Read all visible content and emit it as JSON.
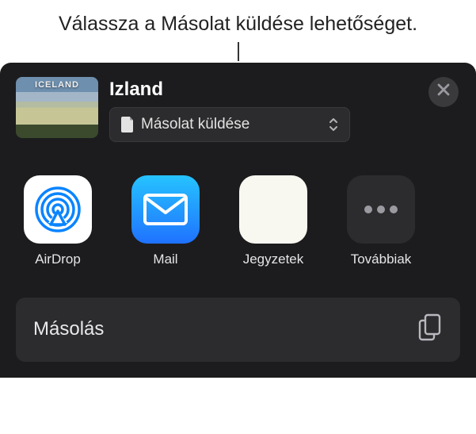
{
  "callout": {
    "text": "Válassza a Másolat küldése lehetőséget."
  },
  "header": {
    "thumbnail_caption": "ICELAND",
    "title": "Izland",
    "dropdown_label": "Másolat küldése"
  },
  "apps": [
    {
      "name": "airdrop",
      "label": "AirDrop"
    },
    {
      "name": "mail",
      "label": "Mail"
    },
    {
      "name": "notes",
      "label": "Jegyzetek"
    },
    {
      "name": "more",
      "label": "Továbbiak"
    }
  ],
  "actions": {
    "copy_label": "Másolás"
  }
}
